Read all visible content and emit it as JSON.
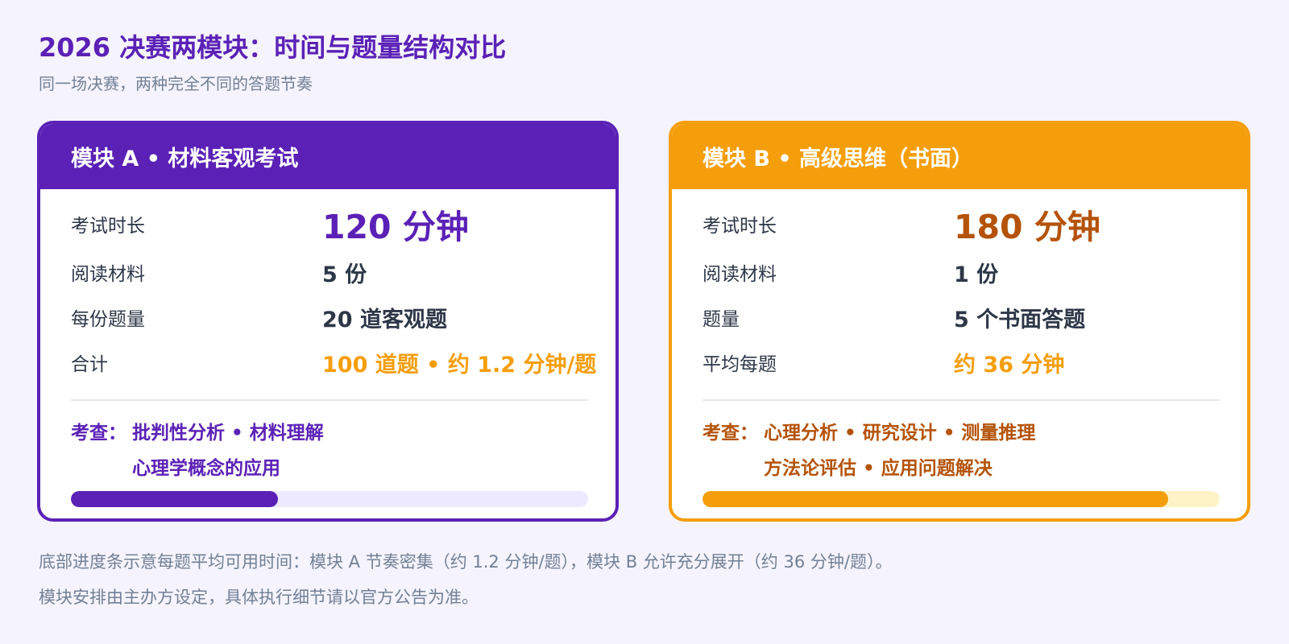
{
  "header": {
    "title": "2026 决赛两模块：时间与题量结构对比",
    "subtitle": "同一场决赛，两种完全不同的答题节奏"
  },
  "modules": [
    {
      "title": "模块 A • 材料客观考试",
      "rows": [
        {
          "label": "考试时长",
          "value": "120 分钟"
        },
        {
          "label": "阅读材料",
          "value": "5 份"
        },
        {
          "label": "每份题量",
          "value": "20 道客观题"
        },
        {
          "label": "合计",
          "value": "100 道题 • 约 1.2 分钟/题"
        }
      ],
      "focus_prefix": "考查：",
      "focus_lines": [
        "批判性分析 • 材料理解",
        "心理学概念的应用"
      ],
      "bar_fraction": 0.4,
      "accent_color": "#5b21b6"
    },
    {
      "title": "模块 B • 高级思维（书面）",
      "rows": [
        {
          "label": "考试时长",
          "value": "180 分钟"
        },
        {
          "label": "阅读材料",
          "value": "1 份"
        },
        {
          "label": "题量",
          "value": "5 个书面答题"
        },
        {
          "label": "平均每题",
          "value": "约 36 分钟"
        }
      ],
      "focus_prefix": "考查：",
      "focus_lines": [
        "心理分析 • 研究设计 • 测量推理",
        "方法论评估 • 应用问题解决"
      ],
      "bar_fraction": 0.9,
      "accent_color": "#f59e0b"
    }
  ],
  "footnotes": [
    "底部进度条示意每题平均可用时间：模块 A 节奏密集（约 1.2 分钟/题），模块 B 允许充分展开（约 36 分钟/题）。",
    "模块安排由主办方设定，具体执行细节请以官方公告为准。"
  ]
}
